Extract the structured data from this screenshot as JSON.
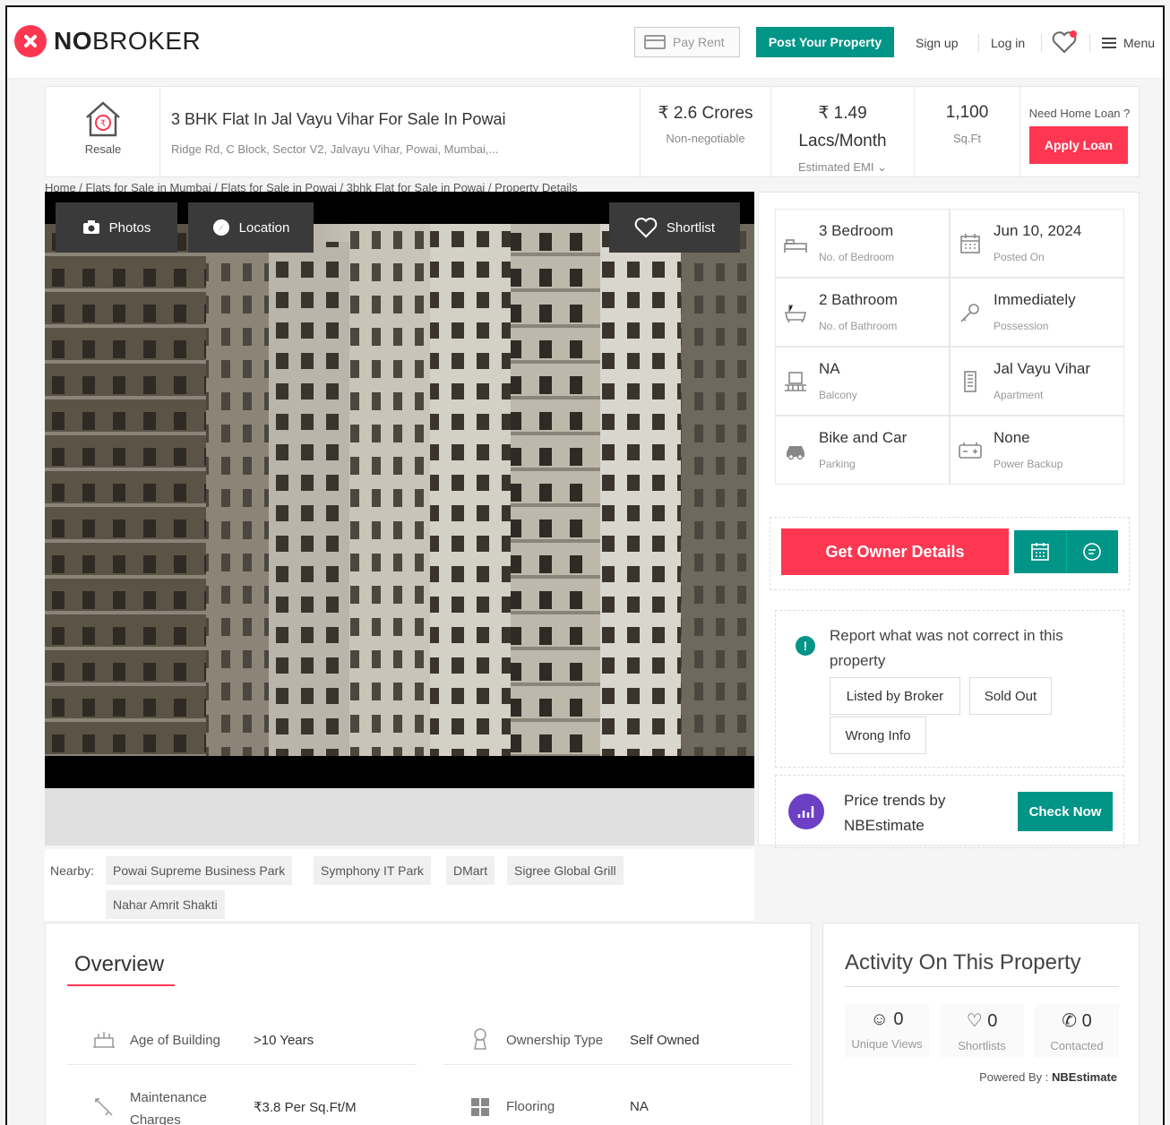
{
  "header": {
    "brand_bold": "NO",
    "brand_rest": "BROKER",
    "pay_rent": "Pay Rent",
    "post_property": "Post Your Property",
    "sign_up": "Sign up",
    "log_in": "Log in",
    "menu": "Menu"
  },
  "listing": {
    "type_label": "Resale",
    "title": "3 BHK Flat In Jal Vayu Vihar For Sale In Powai",
    "address": "Ridge Rd, C Block, Sector V2, Jalvayu Vihar, Powai, Mumbai,...",
    "price": "₹ 2.6 Crores",
    "price_note": "Non-negotiable",
    "emi_value": "₹ 1.49",
    "emi_unit": "Lacs/Month",
    "emi_label": "Estimated EMI",
    "area": "1,100",
    "area_unit": "Sq.Ft",
    "loan_question": "Need Home Loan ?",
    "apply_loan": "Apply Loan"
  },
  "breadcrumb": "Home / Flats for Sale in Mumbai / Flats for Sale in Powai / 3bhk Flat for Sale in Powai / Property Details",
  "gallery": {
    "photos": "Photos",
    "location": "Location",
    "shortlist": "Shortlist"
  },
  "details": [
    {
      "icon": "bed-icon",
      "value": "3 Bedroom",
      "label": "No. of Bedroom"
    },
    {
      "icon": "calendar-icon",
      "value": "Jun 10, 2024",
      "label": "Posted On"
    },
    {
      "icon": "bathtub-icon",
      "value": "2 Bathroom",
      "label": "No. of Bathroom"
    },
    {
      "icon": "key-icon",
      "value": "Immediately",
      "label": "Possession"
    },
    {
      "icon": "balcony-icon",
      "value": "NA",
      "label": "Balcony"
    },
    {
      "icon": "building-icon",
      "value": "Jal Vayu Vihar",
      "label": "Apartment"
    },
    {
      "icon": "car-icon",
      "value": "Bike and Car",
      "label": "Parking"
    },
    {
      "icon": "battery-icon",
      "value": "None",
      "label": "Power Backup"
    }
  ],
  "actions": {
    "get_owner": "Get Owner Details"
  },
  "report": {
    "text": "Report what was not correct in this property",
    "chips": [
      "Listed by Broker",
      "Sold Out",
      "Wrong Info"
    ]
  },
  "trends": {
    "text": "Price trends by NBEstimate",
    "check_now": "Check Now"
  },
  "nearby": {
    "label": "Nearby:",
    "places": [
      "Powai Supreme Business Park",
      "Symphony IT Park",
      "DMart",
      "Sigree Global Grill",
      "Nahar Amrit Shakti"
    ]
  },
  "overview": {
    "title": "Overview",
    "rows": [
      {
        "key": "Age of Building",
        "value": ">10 Years"
      },
      {
        "key": "Ownership Type",
        "value": "Self Owned"
      },
      {
        "key": "Maintenance Charges",
        "value": "₹3.8 Per Sq.Ft/M"
      },
      {
        "key": "Flooring",
        "value": "NA"
      }
    ]
  },
  "activity": {
    "title": "Activity On This Property",
    "stats": [
      {
        "count": "0",
        "label": "Unique Views"
      },
      {
        "count": "0",
        "label": "Shortlists"
      },
      {
        "count": "0",
        "label": "Contacted"
      }
    ],
    "powered_label": "Powered By :",
    "powered_by": "NBEstimate"
  },
  "colors": {
    "brand_red": "#fd3752",
    "brand_teal": "#009587",
    "trend_purple": "#6c3fc5"
  }
}
